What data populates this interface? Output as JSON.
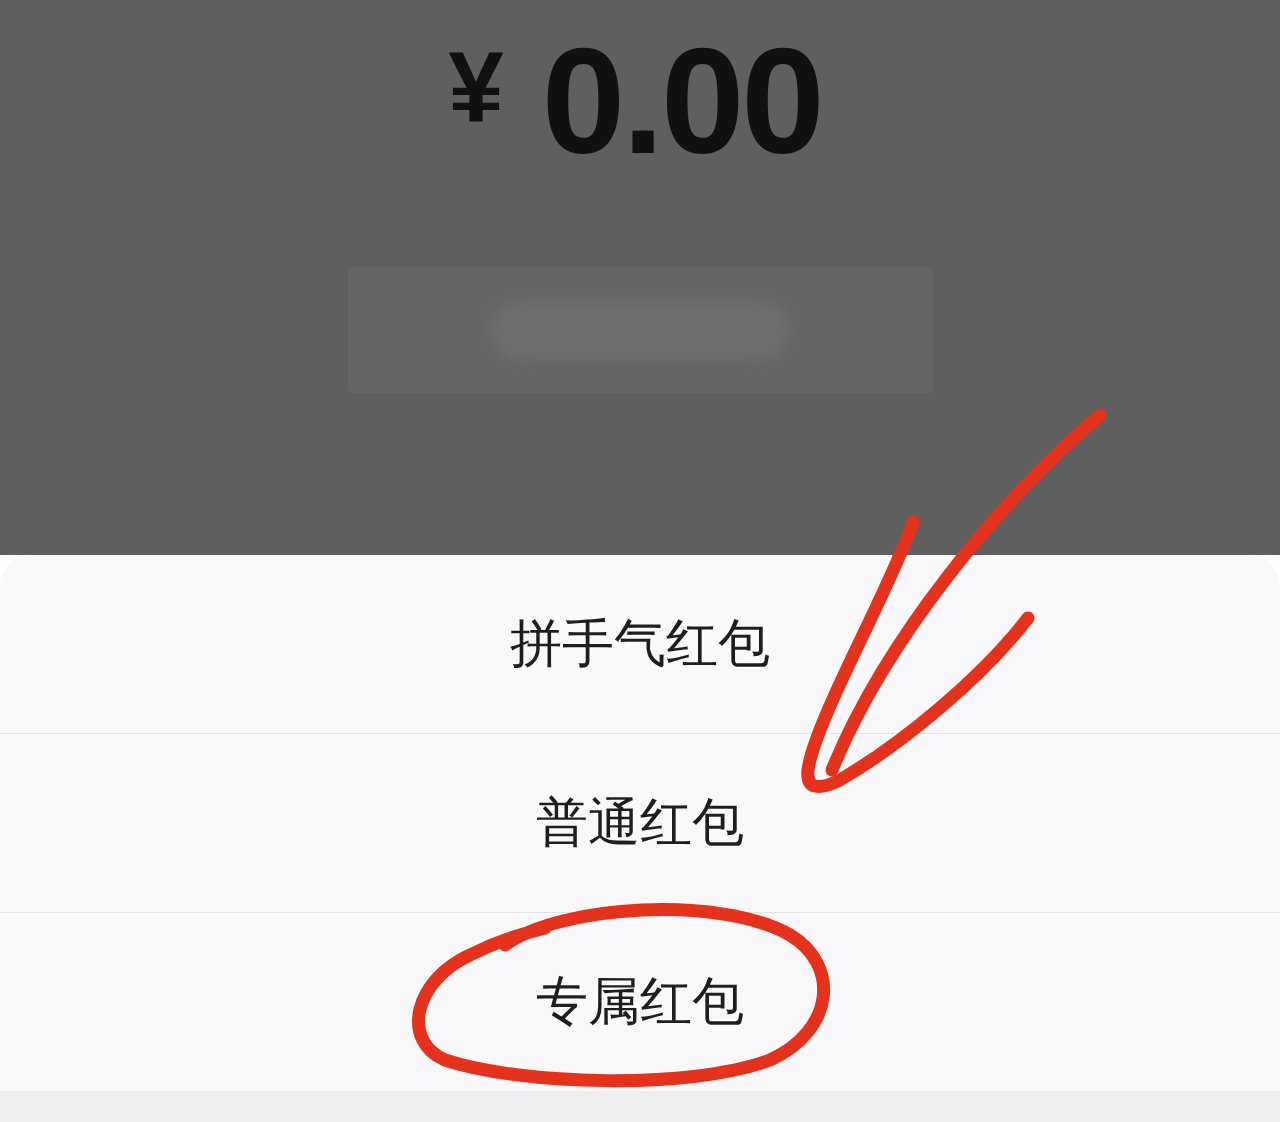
{
  "amount": {
    "currency": "¥",
    "value": "0.00"
  },
  "send_button": {
    "disabled": true
  },
  "sheet": {
    "options": [
      {
        "label": "拼手气红包",
        "circled": false
      },
      {
        "label": "普通红包",
        "circled": false
      },
      {
        "label": "专属红包",
        "circled": true
      }
    ]
  },
  "annotations": [
    {
      "kind": "arrow"
    }
  ]
}
